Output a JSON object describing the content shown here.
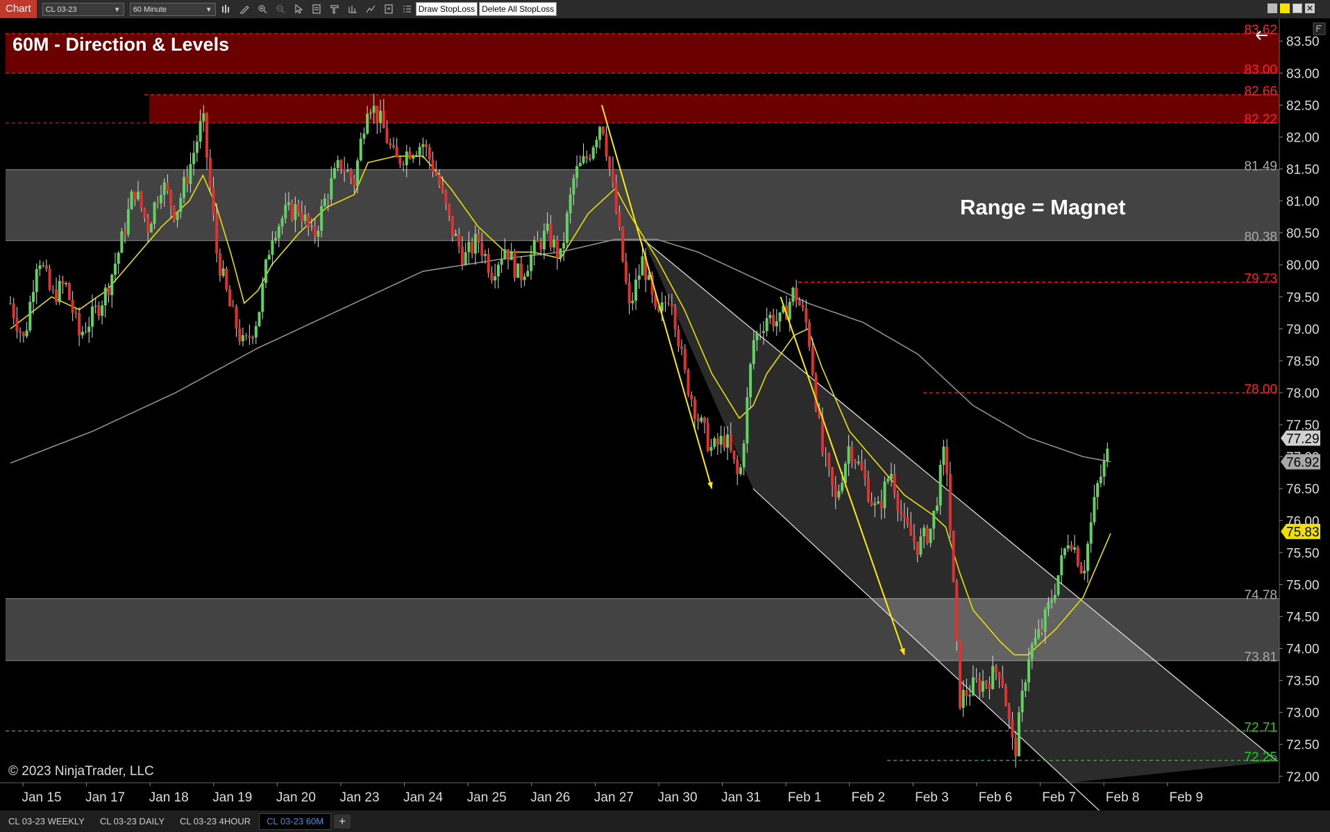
{
  "toolbar": {
    "chart_label": "Chart",
    "instrument": "CL 03-23",
    "interval": "60 Minute",
    "draw_stoploss_label": "Draw StopLoss",
    "delete_stoploss_label": "Delete All StopLoss"
  },
  "bottom_tabs": [
    {
      "label": "CL 03-23 WEEKLY",
      "active": false
    },
    {
      "label": "CL 03-23 DAILY",
      "active": false
    },
    {
      "label": "CL 03-23 4HOUR",
      "active": false
    },
    {
      "label": "CL 03-23 60M",
      "active": true
    }
  ],
  "add_tab_label": "+",
  "colors": {
    "up_candle": "#5fd35f",
    "down_candle": "#e03030",
    "resistance_zone": "#6b0000",
    "range_zone": "#4a4a4a",
    "fast_ma": "#e8e000",
    "slow_ma": "#909090",
    "red_level": "#ff2020",
    "green_level": "#22cc22",
    "yellow_arrow": "#ffee00"
  },
  "chart_data": {
    "type": "candlestick",
    "title": "60M - Direction & Levels",
    "annotation": "Range = Magnet",
    "copyright": "© 2023 NinjaTrader, LLC",
    "x_labels": [
      "Jan 15",
      "Jan 17",
      "Jan 18",
      "Jan 19",
      "Jan 20",
      "Jan 23",
      "Jan 24",
      "Jan 25",
      "Jan 26",
      "Jan 27",
      "Jan 30",
      "Jan 31",
      "Feb 1",
      "Feb 2",
      "Feb 3",
      "Feb 6",
      "Feb 7",
      "Feb 8",
      "Feb 9"
    ],
    "y_ticks": [
      "72.00",
      "72.50",
      "73.00",
      "73.50",
      "74.00",
      "74.50",
      "75.00",
      "75.50",
      "76.00",
      "76.50",
      "77.00",
      "77.50",
      "78.00",
      "78.50",
      "79.00",
      "79.50",
      "80.00",
      "80.50",
      "81.00",
      "81.50",
      "82.00",
      "82.50",
      "83.00",
      "83.50"
    ],
    "ylim": [
      71.9,
      83.85
    ],
    "price_path": [
      [
        0,
        79.4
      ],
      [
        1,
        78.8
      ],
      [
        2,
        80.2
      ],
      [
        3,
        79.5
      ],
      [
        4,
        79.7
      ],
      [
        5,
        78.9
      ],
      [
        6,
        79.2
      ],
      [
        7,
        79.6
      ],
      [
        8,
        80.3
      ],
      [
        9,
        81.2
      ],
      [
        10,
        80.6
      ],
      [
        11,
        81.3
      ],
      [
        12,
        80.8
      ],
      [
        13,
        81.5
      ],
      [
        14,
        82.3
      ],
      [
        15,
        80.2
      ],
      [
        16,
        79.3
      ],
      [
        17,
        78.7
      ],
      [
        18,
        79.2
      ],
      [
        19,
        80.5
      ],
      [
        20,
        80.8
      ],
      [
        21,
        80.9
      ],
      [
        22,
        80.4
      ],
      [
        23,
        81.1
      ],
      [
        24,
        81.6
      ],
      [
        25,
        81.3
      ],
      [
        26,
        82.6
      ],
      [
        27,
        82.2
      ],
      [
        28,
        81.6
      ],
      [
        29,
        81.8
      ],
      [
        30,
        81.9
      ],
      [
        31,
        81.4
      ],
      [
        32,
        80.6
      ],
      [
        33,
        80.1
      ],
      [
        34,
        80.4
      ],
      [
        35,
        79.9
      ],
      [
        36,
        80.3
      ],
      [
        37,
        79.8
      ],
      [
        38,
        80.2
      ],
      [
        39,
        80.5
      ],
      [
        40,
        80.1
      ],
      [
        41,
        81.4
      ],
      [
        42,
        81.7
      ],
      [
        43,
        82.3
      ],
      [
        44,
        80.9
      ],
      [
        45,
        79.3
      ],
      [
        46,
        80.1
      ],
      [
        47,
        79.1
      ],
      [
        48,
        79.6
      ],
      [
        49,
        78.3
      ],
      [
        50,
        77.6
      ],
      [
        51,
        77.1
      ],
      [
        52,
        77.3
      ],
      [
        53,
        76.6
      ],
      [
        54,
        78.8
      ],
      [
        55,
        79.2
      ],
      [
        56,
        79.1
      ],
      [
        57,
        79.6
      ],
      [
        58,
        79.0
      ],
      [
        59,
        77.1
      ],
      [
        60,
        76.3
      ],
      [
        61,
        77.2
      ],
      [
        62,
        76.7
      ],
      [
        63,
        76.1
      ],
      [
        64,
        76.8
      ],
      [
        65,
        75.9
      ],
      [
        66,
        75.6
      ],
      [
        67,
        75.9
      ],
      [
        68,
        77.2
      ],
      [
        69,
        73.2
      ],
      [
        70,
        73.4
      ],
      [
        71,
        73.5
      ],
      [
        72,
        73.7
      ],
      [
        73,
        72.3
      ],
      [
        74,
        73.9
      ],
      [
        75,
        74.3
      ],
      [
        76,
        75.0
      ],
      [
        77,
        75.8
      ],
      [
        78,
        75.2
      ],
      [
        79,
        76.5
      ],
      [
        80,
        77.2
      ]
    ],
    "moving_averages": [
      {
        "name": "fast",
        "color": "#e8e000",
        "values": [
          [
            0,
            79.0
          ],
          [
            3,
            79.5
          ],
          [
            5,
            79.3
          ],
          [
            7,
            79.6
          ],
          [
            9,
            80.1
          ],
          [
            11,
            80.6
          ],
          [
            13,
            81.0
          ],
          [
            14,
            81.4
          ],
          [
            15,
            80.9
          ],
          [
            16,
            80.2
          ],
          [
            17,
            79.4
          ],
          [
            18,
            79.6
          ],
          [
            19,
            80.0
          ],
          [
            21,
            80.5
          ],
          [
            23,
            80.9
          ],
          [
            25,
            81.1
          ],
          [
            26,
            81.6
          ],
          [
            28,
            81.7
          ],
          [
            30,
            81.7
          ],
          [
            32,
            81.2
          ],
          [
            34,
            80.6
          ],
          [
            36,
            80.2
          ],
          [
            38,
            80.2
          ],
          [
            40,
            80.1
          ],
          [
            42,
            80.8
          ],
          [
            44,
            81.2
          ],
          [
            45,
            80.8
          ],
          [
            47,
            80.1
          ],
          [
            49,
            79.3
          ],
          [
            51,
            78.3
          ],
          [
            53,
            77.6
          ],
          [
            54,
            77.8
          ],
          [
            55,
            78.3
          ],
          [
            57,
            78.9
          ],
          [
            58,
            79.0
          ],
          [
            59,
            78.4
          ],
          [
            61,
            77.4
          ],
          [
            63,
            76.9
          ],
          [
            65,
            76.4
          ],
          [
            67,
            76.1
          ],
          [
            68,
            75.9
          ],
          [
            69,
            75.2
          ],
          [
            70,
            74.6
          ],
          [
            72,
            74.1
          ],
          [
            73,
            73.9
          ],
          [
            74,
            73.9
          ],
          [
            76,
            74.3
          ],
          [
            78,
            74.8
          ],
          [
            80,
            75.8
          ]
        ]
      },
      {
        "name": "slow",
        "color": "#909090",
        "values": [
          [
            0,
            76.9
          ],
          [
            6,
            77.4
          ],
          [
            12,
            78.0
          ],
          [
            18,
            78.7
          ],
          [
            24,
            79.3
          ],
          [
            30,
            79.9
          ],
          [
            36,
            80.1
          ],
          [
            40,
            80.2
          ],
          [
            44,
            80.4
          ],
          [
            47,
            80.4
          ],
          [
            50,
            80.2
          ],
          [
            54,
            79.8
          ],
          [
            58,
            79.4
          ],
          [
            62,
            79.1
          ],
          [
            66,
            78.6
          ],
          [
            70,
            77.8
          ],
          [
            74,
            77.3
          ],
          [
            78,
            77.0
          ],
          [
            80,
            76.92
          ]
        ]
      }
    ],
    "zones": [
      {
        "label_low": "83.00",
        "label_high": "83.62",
        "low": 83.0,
        "high": 83.62,
        "color": "#6b0000"
      },
      {
        "label_low": "82.22",
        "label_high": "82.66",
        "low": 82.22,
        "high": 82.66,
        "color": "#6b0000"
      },
      {
        "label_low": "80.38",
        "label_high": "81.49",
        "low": 80.38,
        "high": 81.49,
        "color": "#4a4a4a"
      },
      {
        "label_low": "73.81",
        "label_high": "74.78",
        "low": 73.81,
        "high": 74.78,
        "color": "#4a4a4a"
      }
    ],
    "levels": [
      {
        "label": "79.73",
        "value": 79.73,
        "color": "#ff2020"
      },
      {
        "label": "78.00",
        "value": 78.0,
        "color": "#ff2020"
      },
      {
        "label": "72.71",
        "value": 72.71,
        "color": "#22cc22"
      },
      {
        "label": "72.25",
        "value": 72.25,
        "color": "#22cc22"
      }
    ],
    "price_markers": [
      {
        "label": "77.29",
        "value": 77.29,
        "bg": "#d0d0d0"
      },
      {
        "label": "76.92",
        "value": 76.92,
        "bg": "#a8a8a8"
      },
      {
        "label": "75.83",
        "value": 75.83,
        "bg": "#f0e000"
      }
    ],
    "channel": {
      "upper": [
        [
          46,
          80.4
        ],
        [
          80,
          72.3
        ]
      ],
      "lower": [
        [
          54,
          76.5
        ],
        [
          77,
          71.9
        ]
      ]
    },
    "arrows": [
      {
        "from": [
          43,
          82.5
        ],
        "to": [
          51,
          76.5
        ]
      },
      {
        "from": [
          56,
          79.5
        ],
        "to": [
          65,
          73.9
        ]
      }
    ]
  }
}
